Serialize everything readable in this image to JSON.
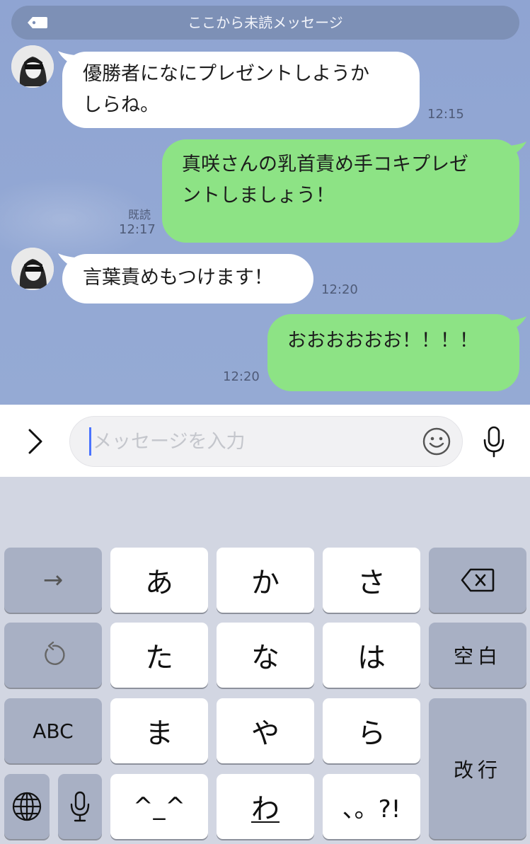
{
  "unread_bar": {
    "label": "ここから未読メッセージ",
    "icon": "tag-icon"
  },
  "messages": [
    {
      "side": "in",
      "text": "優勝者になにプレゼントしようか\nしらね。",
      "time": "12:15"
    },
    {
      "side": "out",
      "text": "真咲さんの乳首責め手コキプレゼ\nントしましょう！",
      "read": "既読",
      "time": "12:17"
    },
    {
      "side": "in",
      "text": "言葉責めもつけます！",
      "time": "12:20"
    },
    {
      "side": "out",
      "text": "おおおおおお！！！！",
      "time": "12:20"
    }
  ],
  "input": {
    "placeholder": "メッセージを入力",
    "expand_icon": "chevron-right-icon",
    "emoji_icon": "smiley-icon",
    "mic_icon": "microphone-icon"
  },
  "keyboard": {
    "keys": {
      "arrow": "→",
      "a": "あ",
      "ka": "か",
      "sa": "さ",
      "ta": "た",
      "na": "な",
      "ha": "は",
      "ma": "ま",
      "ya": "や",
      "ra": "ら",
      "emoticon": "^_^",
      "wa": "わ",
      "punct": "、。?!",
      "space": "空白",
      "abc": "ABC",
      "enter": "改行"
    },
    "icons": [
      "delete-icon",
      "undo-icon",
      "globe-icon",
      "dictation-mic-icon"
    ]
  },
  "colors": {
    "incoming": "#ffffff",
    "outgoing": "#8de385",
    "chat_bg": "#8fa4d2"
  }
}
